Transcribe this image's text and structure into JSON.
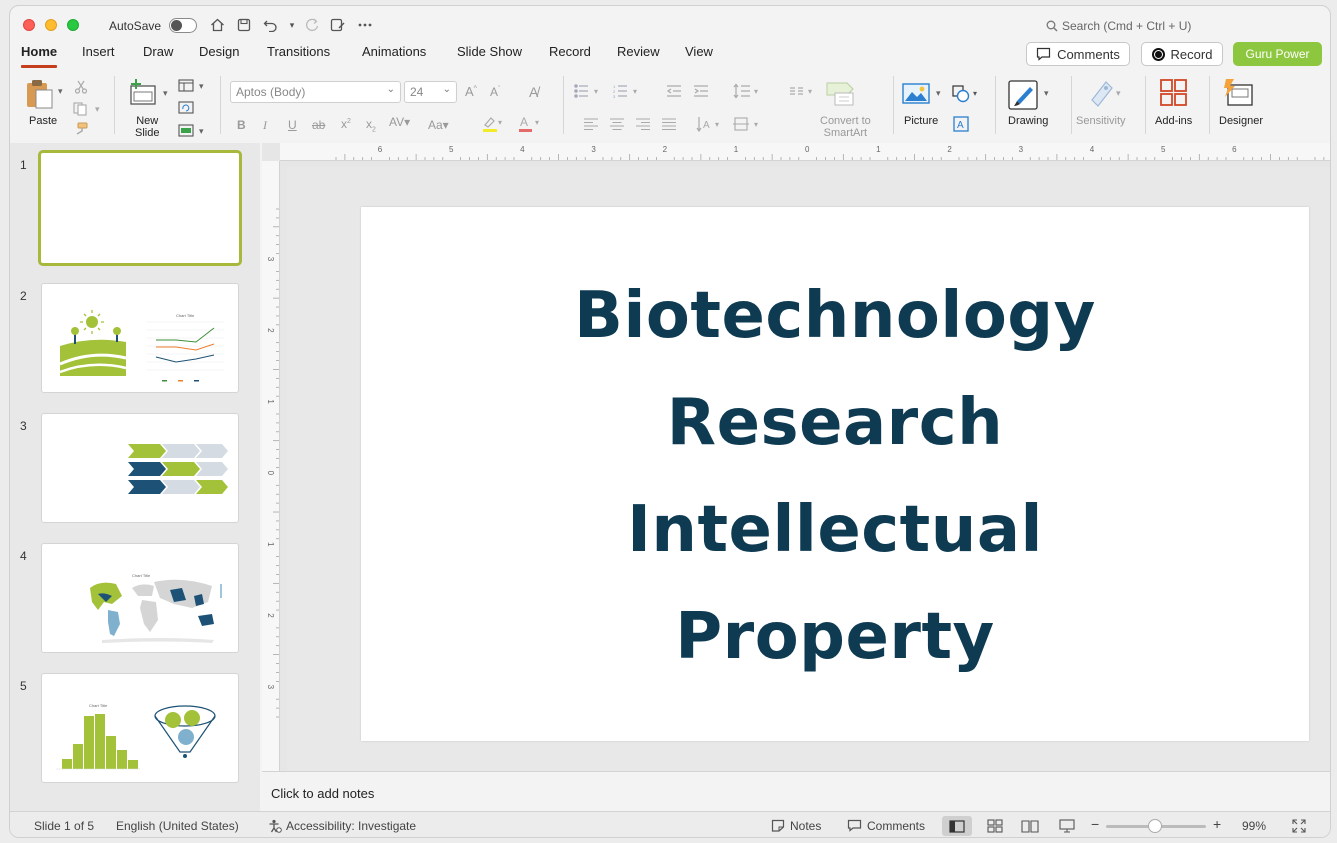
{
  "titlebar": {
    "autosave_label": "AutoSave",
    "search_placeholder": "Search (Cmd + Ctrl + U)"
  },
  "tabs": [
    {
      "label": "Home",
      "active": true
    },
    {
      "label": "Insert"
    },
    {
      "label": "Draw"
    },
    {
      "label": "Design"
    },
    {
      "label": "Transitions"
    },
    {
      "label": "Animations"
    },
    {
      "label": "Slide Show"
    },
    {
      "label": "Record"
    },
    {
      "label": "Review"
    },
    {
      "label": "View"
    }
  ],
  "header_buttons": {
    "comments": "Comments",
    "record": "Record",
    "guru": "Guru Power"
  },
  "ribbon": {
    "paste": "Paste",
    "new_slide": "New\nSlide",
    "font_name": "Aptos (Body)",
    "font_size": "24",
    "convert_smartart": "Convert to\nSmartArt",
    "picture": "Picture",
    "drawing": "Drawing",
    "sensitivity": "Sensitivity",
    "addins": "Add-ins",
    "designer": "Designer"
  },
  "ruler": {
    "h_labels": [
      "6",
      "5",
      "4",
      "3",
      "2",
      "1",
      "0",
      "1",
      "2",
      "3",
      "4",
      "5",
      "6"
    ],
    "v_labels": [
      "3",
      "2",
      "1",
      "0",
      "1",
      "2",
      "3"
    ]
  },
  "thumbnails": [
    {
      "num": "1",
      "selected": true
    },
    {
      "num": "2",
      "chart_title": "Chart Title"
    },
    {
      "num": "3"
    },
    {
      "num": "4",
      "chart_title": "Chart Title"
    },
    {
      "num": "5",
      "chart_title": "Chart Title"
    }
  ],
  "slide": {
    "title_lines": [
      "Biotechnology",
      "Research",
      "Intellectual",
      "Property"
    ]
  },
  "notes_placeholder": "Click to add notes",
  "statusbar": {
    "slide_info": "Slide 1 of 5",
    "language": "English (United States)",
    "accessibility": "Accessibility: Investigate",
    "notes": "Notes",
    "comments": "Comments",
    "zoom": "99%"
  },
  "colors": {
    "accent_tab": "#c43e1c",
    "guru_button": "#8dc63f",
    "slide_title": "#0e3a52",
    "thumb_green": "#a3c23a",
    "thumb_navy": "#1d5276"
  }
}
